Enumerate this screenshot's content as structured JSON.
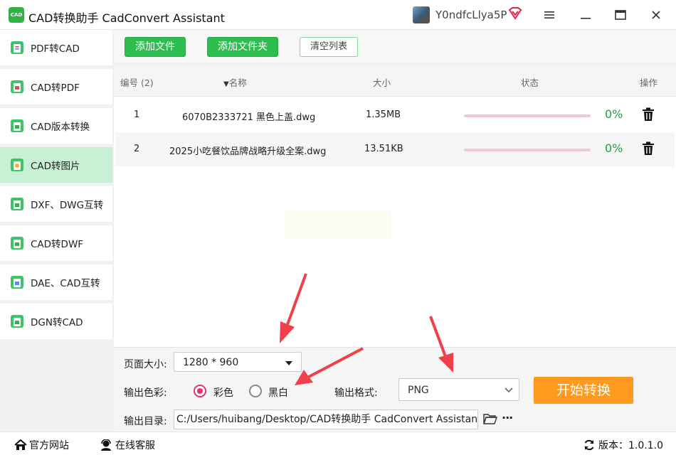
{
  "app": {
    "logo_text": "CAD",
    "title": "CAD转换助手 CadConvert Assistant",
    "username": "Y0ndfcLlya5P"
  },
  "sidebar": {
    "items": [
      {
        "label": "PDF转CAD"
      },
      {
        "label": "CAD转PDF"
      },
      {
        "label": "CAD版本转换"
      },
      {
        "label": "CAD转图片",
        "active": true
      },
      {
        "label": "DXF、DWG互转"
      },
      {
        "label": "CAD转DWF"
      },
      {
        "label": "DAE、CAD互转"
      },
      {
        "label": "DGN转CAD"
      }
    ]
  },
  "toolbar": {
    "add_file": "添加文件",
    "add_folder": "添加文件夹",
    "clear_list": "清空列表"
  },
  "table": {
    "headers": {
      "index": "编号 (2)",
      "name": "名称",
      "size": "大小",
      "status": "状态",
      "action": "操作"
    },
    "rows": [
      {
        "index": "1",
        "name": "6070B2333721 黑色上盖.dwg",
        "size": "1.35MB",
        "progress": 0,
        "percent": "0%"
      },
      {
        "index": "2",
        "name": "2025小吃餐饮品牌战略升级全案.dwg",
        "size": "13.51KB",
        "progress": 0,
        "percent": "0%"
      }
    ]
  },
  "settings": {
    "page_size_label": "页面大小:",
    "page_size_value": "1280 * 960",
    "color_label": "输出色彩:",
    "color_option": "彩色",
    "bw_option": "黑白",
    "selected_color": "color",
    "format_label": "输出格式:",
    "format_value": "PNG",
    "start_button": "开始转换",
    "output_dir_label": "输出目录:",
    "output_dir_value": "C:/Users/huibang/Desktop/CAD转换助手 CadConvert Assistant",
    "more": "···"
  },
  "statusbar": {
    "website": "官方网站",
    "support": "在线客服",
    "version": "版本：1.0.1.0"
  },
  "colors": {
    "accent_green": "#2ebd4f",
    "sidebar_active": "#c8f0d4",
    "start_orange": "#ff9a1f",
    "radio_pink": "#e0356a",
    "percent_green": "#2a9a3c"
  }
}
